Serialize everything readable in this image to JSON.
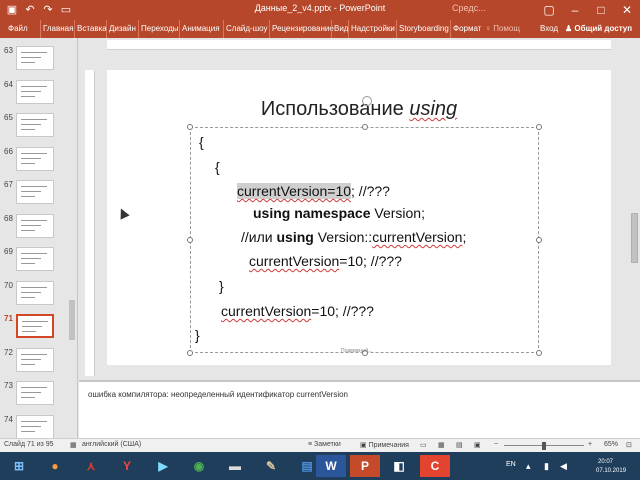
{
  "window": {
    "title": "Данные_2_v4.pptx - PowerPoint",
    "tools_hint": "Средс...",
    "brand_color": "#b7472a"
  },
  "ribbon": {
    "tabs": [
      "Файл",
      "Главная",
      "Вставка",
      "Дизайн",
      "Переходы",
      "Анимация",
      "Слайд-шоу",
      "Рецензирование",
      "Вид",
      "Надстройки",
      "Storyboarding",
      "Формат"
    ],
    "help_search": "Помощ",
    "signin": "Вход",
    "share": "Общий доступ"
  },
  "thumbnails": [
    {
      "num": "63"
    },
    {
      "num": "64"
    },
    {
      "num": "65"
    },
    {
      "num": "66"
    },
    {
      "num": "67"
    },
    {
      "num": "68"
    },
    {
      "num": "69"
    },
    {
      "num": "70"
    },
    {
      "num": "71"
    },
    {
      "num": "72"
    },
    {
      "num": "73"
    },
    {
      "num": "74"
    }
  ],
  "active_slide": "71",
  "slide": {
    "title_plain": "Использование ",
    "title_italic": "using",
    "code": {
      "l1": "{",
      "l2": "{",
      "l3a": "currentVersion=10",
      "l3b": "; //???",
      "l4a": "using namespace",
      "l4b": " Version;",
      "l5a": "//или ",
      "l5b": "using",
      "l5c": " Version::",
      "l5d": "currentVersion",
      "l5e": ";",
      "l6a": "currentVersion",
      "l6b": "=10; //???",
      "l7": "}",
      "l8a": "currentVersion",
      "l8b": "=10; //???",
      "l9": "}"
    },
    "footer_placeholder": "Подвижный..."
  },
  "notes": {
    "text": "ошибка компилятора: неопределенный идентификатор currentVersion"
  },
  "status": {
    "slide_info": "Слайд 71 из 95",
    "language": "английский (США)",
    "notes_btn": "Заметки",
    "comments_btn": "Примечания",
    "zoom": "65%"
  },
  "tray": {
    "lang": "EN",
    "time": "20:07",
    "date": "07.10.2019"
  }
}
